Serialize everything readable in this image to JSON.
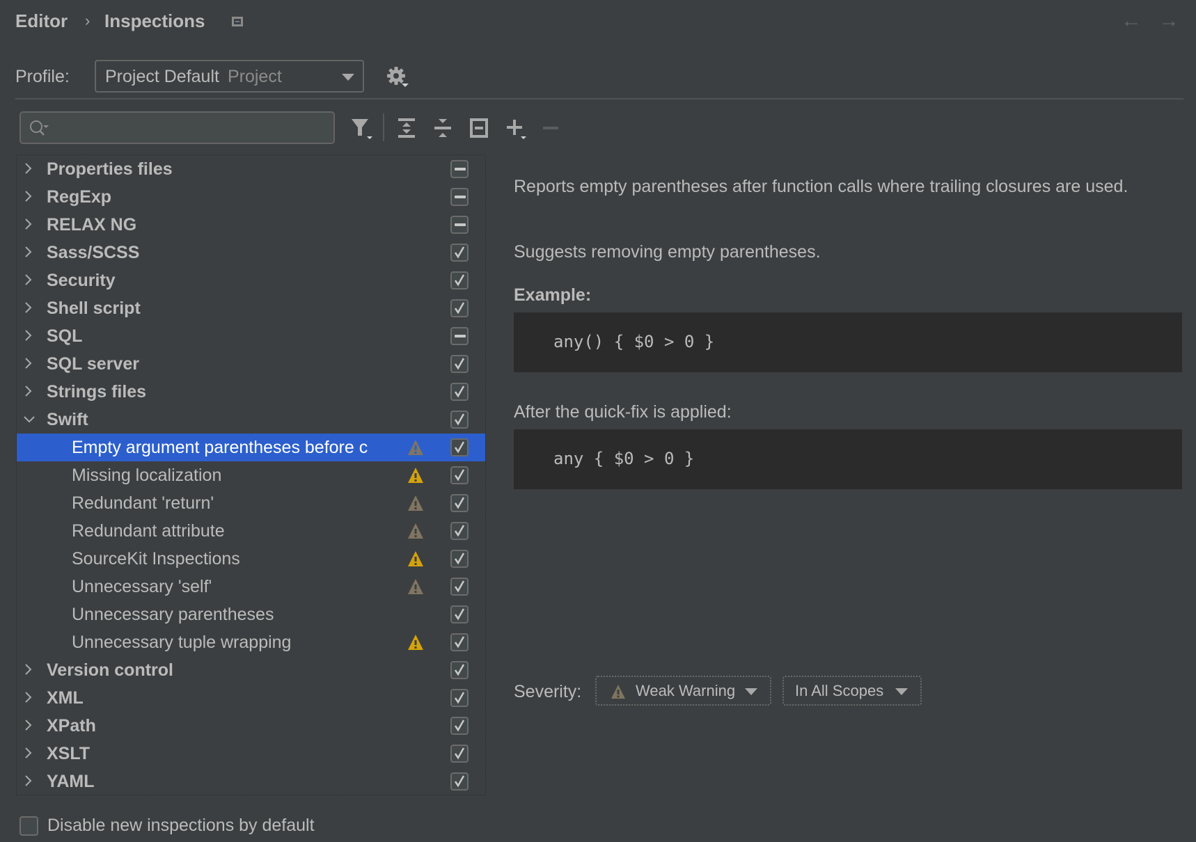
{
  "header": {
    "breadcrumb": [
      "Editor",
      "Inspections"
    ],
    "breadcrumb_separator": "›",
    "nav_back": "←",
    "nav_forward": "→"
  },
  "profile": {
    "label": "Profile:",
    "value": "Project Default",
    "scope": "Project"
  },
  "search": {
    "value": "",
    "placeholder": ""
  },
  "toolbar": {
    "icons": [
      "filter-icon",
      "expand-all-icon",
      "collapse-all-icon",
      "reset-to-default-icon",
      "add-icon",
      "remove-icon"
    ]
  },
  "colors": {
    "background": "#3c3f41",
    "selection": "#2c5fcd",
    "warning": "#d4a20a",
    "weak_warning": "#7f7560",
    "code_background": "#2b2b2b",
    "text": "#bbbbbb"
  },
  "tree": [
    {
      "label": "Properties files",
      "type": "group",
      "expanded": false,
      "state": "mixed"
    },
    {
      "label": "RegExp",
      "type": "group",
      "expanded": false,
      "state": "mixed"
    },
    {
      "label": "RELAX NG",
      "type": "group",
      "expanded": false,
      "state": "mixed"
    },
    {
      "label": "Sass/SCSS",
      "type": "group",
      "expanded": false,
      "state": "checked"
    },
    {
      "label": "Security",
      "type": "group",
      "expanded": false,
      "state": "checked"
    },
    {
      "label": "Shell script",
      "type": "group",
      "expanded": false,
      "state": "checked"
    },
    {
      "label": "SQL",
      "type": "group",
      "expanded": false,
      "state": "mixed"
    },
    {
      "label": "SQL server",
      "type": "group",
      "expanded": false,
      "state": "checked"
    },
    {
      "label": "Strings files",
      "type": "group",
      "expanded": false,
      "state": "checked"
    },
    {
      "label": "Swift",
      "type": "group",
      "expanded": true,
      "state": "checked"
    },
    {
      "label": "Empty argument parentheses before c",
      "type": "child",
      "severity": "weak",
      "state": "checked",
      "selected": true
    },
    {
      "label": "Missing localization",
      "type": "child",
      "severity": "warning",
      "state": "checked"
    },
    {
      "label": "Redundant 'return'",
      "type": "child",
      "severity": "weak",
      "state": "checked"
    },
    {
      "label": "Redundant attribute",
      "type": "child",
      "severity": "weak",
      "state": "checked"
    },
    {
      "label": "SourceKit Inspections",
      "type": "child",
      "severity": "warning",
      "state": "checked"
    },
    {
      "label": "Unnecessary 'self'",
      "type": "child",
      "severity": "weak",
      "state": "checked"
    },
    {
      "label": "Unnecessary parentheses",
      "type": "child",
      "severity": "none",
      "state": "checked"
    },
    {
      "label": "Unnecessary tuple wrapping",
      "type": "child",
      "severity": "warning",
      "state": "checked"
    },
    {
      "label": "Version control",
      "type": "group",
      "expanded": false,
      "state": "checked"
    },
    {
      "label": "XML",
      "type": "group",
      "expanded": false,
      "state": "checked"
    },
    {
      "label": "XPath",
      "type": "group",
      "expanded": false,
      "state": "checked"
    },
    {
      "label": "XSLT",
      "type": "group",
      "expanded": false,
      "state": "checked"
    },
    {
      "label": "YAML",
      "type": "group",
      "expanded": false,
      "state": "checked"
    }
  ],
  "disable_new": {
    "label": "Disable new inspections by default",
    "checked": false
  },
  "description": {
    "paragraph1": "Reports empty parentheses after function calls where trailing closures are used.",
    "paragraph2": "Suggests removing empty parentheses.",
    "example_heading": "Example:",
    "example_code": "any() { $0 > 0 }",
    "after_heading": "After the quick-fix is applied:",
    "after_code": "any { $0 > 0 }"
  },
  "severity": {
    "label": "Severity:",
    "value": "Weak Warning",
    "scope": "In All Scopes"
  }
}
